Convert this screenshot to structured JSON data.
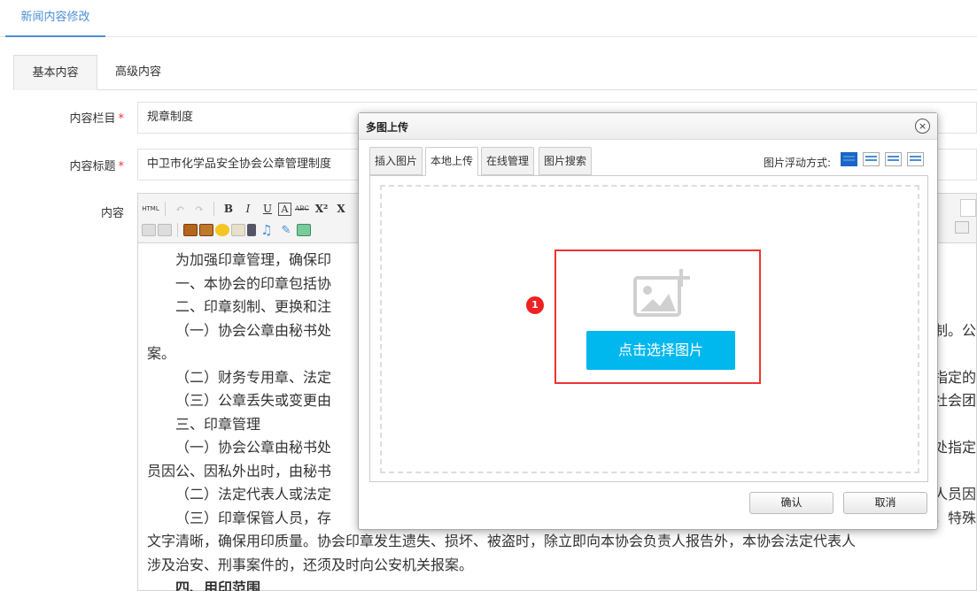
{
  "top_tab": "新闻内容修改",
  "sub_tabs": [
    "基本内容",
    "高级内容"
  ],
  "form": {
    "category_label": "内容栏目",
    "category_value": "规章制度",
    "title_label": "内容标题",
    "title_value": "中卫市化学品安全协会公章管理制度",
    "content_label": "内容",
    "required_mark": "*"
  },
  "toolbar": {
    "row1": [
      "HTML",
      "↶",
      "↷",
      "B",
      "I",
      "U",
      "A",
      "ABC",
      "X²",
      "X"
    ],
    "row2_icons": [
      "align-left-icon",
      "align-justify-icon",
      "image-icon",
      "insert-image-icon",
      "emoji-icon",
      "scrawl-icon",
      "video-icon",
      "music-icon",
      "attachment-icon",
      "map-icon"
    ]
  },
  "content_lines": [
    {
      "text": "为加强印章管理，确保印",
      "indent": true
    },
    {
      "text": "一、本协会的印章包括协",
      "indent": true
    },
    {
      "text": "二、印章刻制、更换和注",
      "indent": true
    },
    {
      "text": "（一）协会公章由秘书处",
      "indent": true,
      "right": "制。公"
    },
    {
      "text": "案。",
      "indent": false
    },
    {
      "text": "（二）财务专用章、法定",
      "indent": true,
      "right": "指定的"
    },
    {
      "text": "（三）公章丢失或变更由",
      "indent": true,
      "right": "社会团"
    },
    {
      "text": " 三、印章管理",
      "indent": true
    },
    {
      "text": "（一）协会公章由秘书处",
      "indent": true,
      "right": "处指定"
    },
    {
      "text": "员因公、因私外出时，由秘书",
      "indent": false
    },
    {
      "text": "（二）法定代表人或法定",
      "indent": true,
      "right": "人员因"
    },
    {
      "text": "（三）印章保管人员，存",
      "indent": true,
      "right": "，特殊"
    },
    {
      "text": "文字清晰，确保用印质量。协会印章发生遗失、损坏、被盗时，除立即向本协会负责人报告外，本协会法定代表人",
      "indent": false
    },
    {
      "text": "涉及治安、刑事案件的，还须及时向公安机关报案。",
      "indent": false
    },
    {
      "text": "四、用印范围",
      "indent": true,
      "bold": true
    }
  ],
  "dialog": {
    "title": "多图上传",
    "close": "×",
    "tabs": [
      "插入图片",
      "本地上传",
      "在线管理",
      "图片搜索"
    ],
    "active_tab": "本地上传",
    "float_label": "图片浮动方式:",
    "float_icons": [
      "float-none-icon",
      "float-left-icon",
      "float-right-icon",
      "float-center-icon"
    ],
    "marker": "1",
    "choose_button": "点击选择图片",
    "confirm": "确认",
    "cancel": "取消"
  },
  "colors": {
    "accent": "#4a8fd4",
    "upload_button": "#00b7ee",
    "highlight": "#e33333",
    "marker": "#e22222"
  }
}
